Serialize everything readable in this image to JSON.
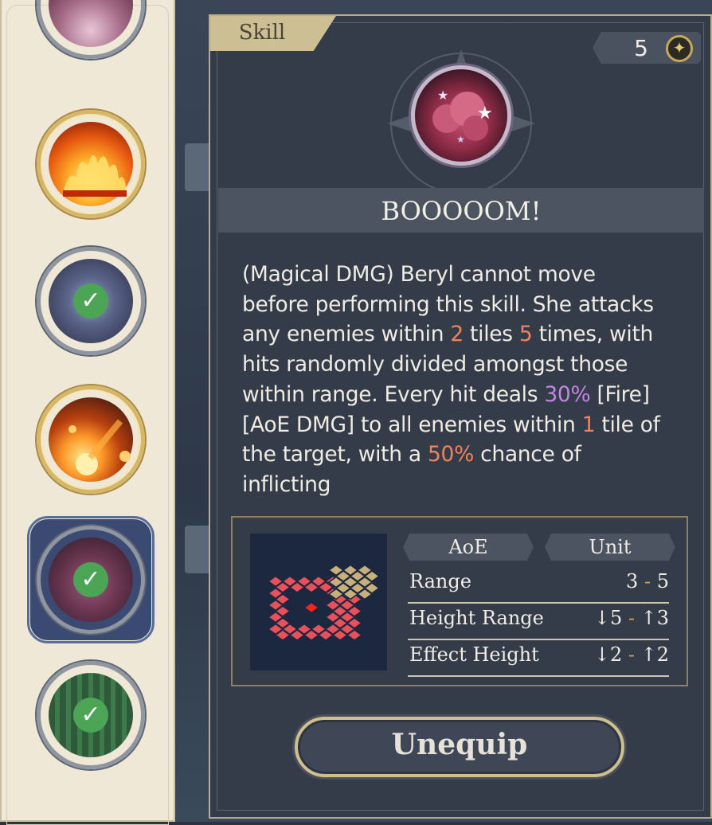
{
  "sidebar": {
    "title": "Skill",
    "slots": [
      {
        "icon": "pink-orb-icon",
        "equipped": false
      },
      {
        "icon": "fire-icon",
        "equipped": false
      },
      {
        "icon": "whirlwind-icon",
        "equipped": true
      },
      {
        "icon": "meteor-icon",
        "equipped": false
      },
      {
        "icon": "explosion-icon",
        "equipped": true,
        "selected": true
      },
      {
        "icon": "wind-blade-icon",
        "equipped": true
      }
    ]
  },
  "panel": {
    "tab_label": "Skill",
    "cost": "5",
    "skill_name": "BOOOOOM!",
    "description": {
      "p1": "(Magical DMG) Beryl cannot move before performing this skill. She attacks any enemies within ",
      "n1": "2",
      "p2": " tiles ",
      "n2": "5",
      "p3": " times, with hits randomly divided amongst those within range. Every hit deals ",
      "n3": "30%",
      "p4": " [Fire] [AoE DMG] to all enemies within ",
      "n4": "1",
      "p5": " tile of the target, with a ",
      "n5": "50%",
      "p6": " chance of inflicting"
    },
    "stats": {
      "aoe_header": "AoE",
      "unit_header": "Unit",
      "rows": [
        {
          "label": "Range",
          "left": "3",
          "right": "5"
        },
        {
          "label": "Height Range",
          "left": "↓5",
          "right": "↑3"
        },
        {
          "label": "Effect Height",
          "left": "↓2",
          "right": "↑2"
        }
      ],
      "dash": "-"
    },
    "unequip_label": "Unequip"
  },
  "colors": {
    "accent_gold": "#cdbf8e",
    "highlight_orange": "#f0825c",
    "highlight_purple": "#c585e6",
    "equipped_check": "#4ba555",
    "aoe_range": "#e8505a",
    "aoe_target": "#c9b07a"
  }
}
